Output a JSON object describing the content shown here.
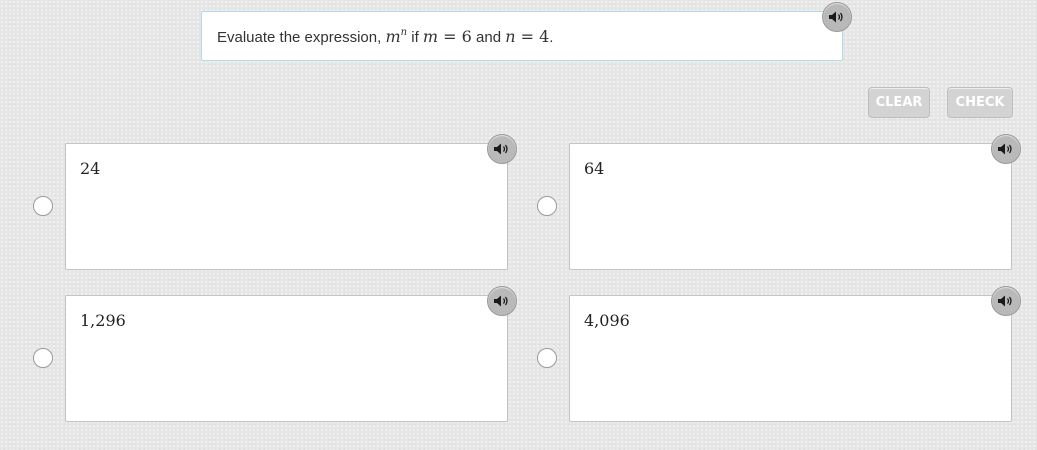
{
  "question": {
    "prefix": "Evaluate the expression, ",
    "base": "m",
    "exponent": "n",
    "if_text": " if ",
    "var1": "m",
    "eq": " = ",
    "val1": "6",
    "and_text": " and ",
    "var2": "n",
    "val2": "4",
    "suffix": "."
  },
  "buttons": {
    "clear_label": "CLEAR",
    "check_label": "CHECK"
  },
  "answers": [
    {
      "label": "24"
    },
    {
      "label": "64"
    },
    {
      "label": "1,296"
    },
    {
      "label": "4,096"
    }
  ],
  "icons": {
    "speaker": "speaker-icon",
    "radio": "radio-icon"
  },
  "colors": {
    "question_border": "#b5dbea",
    "button_bg": "#d3d3d3",
    "speaker_bg": "#b9b9b9"
  }
}
